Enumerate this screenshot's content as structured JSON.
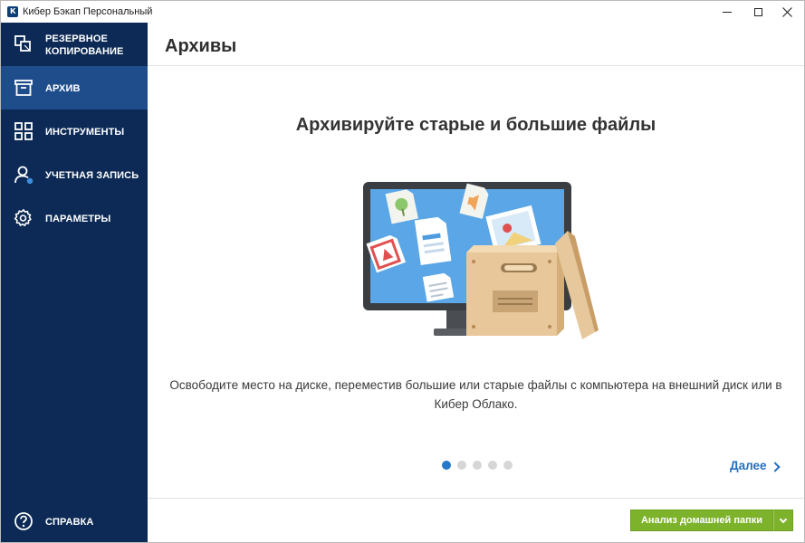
{
  "window": {
    "title": "Кибер Бэкап Персональный",
    "logo_letter": "К"
  },
  "sidebar": {
    "items": [
      {
        "label_line1": "РЕЗЕРВНОЕ",
        "label_line2": "КОПИРОВАНИЕ",
        "icon": "backup-copy-icon",
        "active": false
      },
      {
        "label": "АРХИВ",
        "icon": "archive-box-icon",
        "active": true
      },
      {
        "label": "ИНСТРУМЕНТЫ",
        "icon": "tools-grid-icon",
        "active": false
      },
      {
        "label": "УЧЕТНАЯ ЗАПИСЬ",
        "icon": "account-user-icon",
        "active": false
      },
      {
        "label": "ПАРАМЕТРЫ",
        "icon": "settings-gear-icon",
        "active": false
      }
    ],
    "help": {
      "label": "СПРАВКА",
      "icon": "help-question-icon"
    }
  },
  "header": {
    "title": "Архивы"
  },
  "main": {
    "headline": "Архивируйте старые и большие файлы",
    "description": "Освободите место на диске, переместив большие или старые файлы с компьютера на внешний диск или в Кибер Облако.",
    "pagination": {
      "total": 5,
      "current": 1
    },
    "next_label": "Далее"
  },
  "footer": {
    "primary_button": "Анализ домашней папки"
  },
  "colors": {
    "sidebar_bg": "#0c2a55",
    "sidebar_active": "#1f4d8c",
    "accent_blue": "#2570bd",
    "primary_green": "#7db22b"
  }
}
